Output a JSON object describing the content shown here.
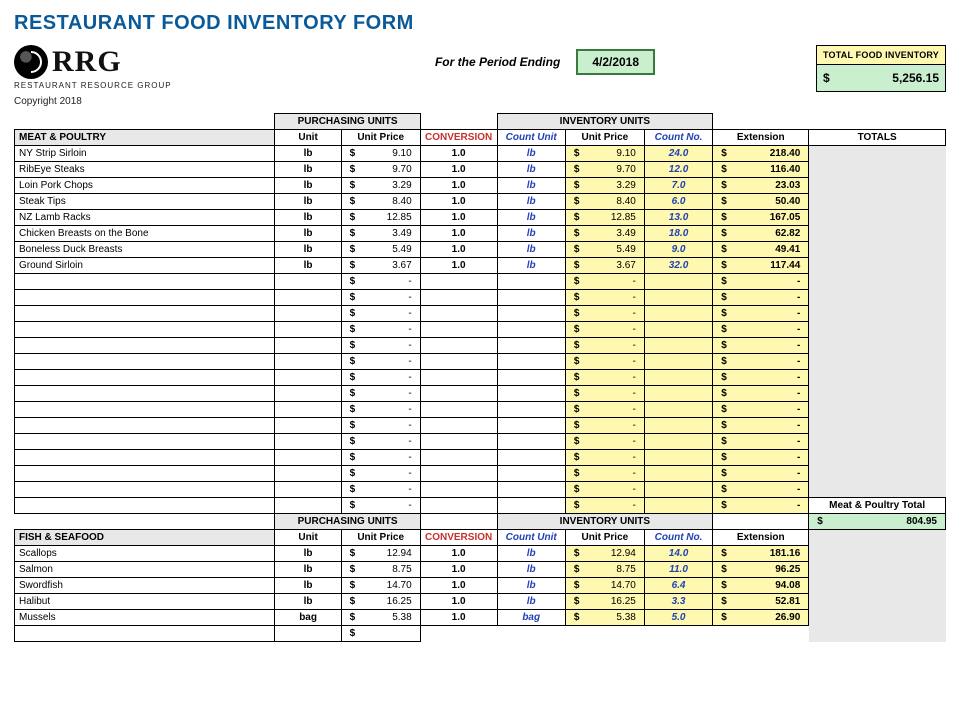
{
  "title": "RESTAURANT FOOD INVENTORY FORM",
  "logo": {
    "text": "RRG",
    "sub": "RESTAURANT RESOURCE GROUP"
  },
  "copyright": "Copyright 2018",
  "period": {
    "label": "For the Period Ending",
    "value": "4/2/2018"
  },
  "grand_total": {
    "label": "TOTAL FOOD INVENTORY",
    "currency": "$",
    "amount": "5,256.15"
  },
  "group_headers": {
    "purchasing": "PURCHASING UNITS",
    "inventory": "INVENTORY UNITS"
  },
  "col_headers": {
    "unit": "Unit",
    "unit_price": "Unit Price",
    "conversion": "CONVERSION",
    "count_unit": "Count Unit",
    "inv_unit_price": "Unit Price",
    "count_no": "Count No.",
    "extension": "Extension",
    "totals": "TOTALS"
  },
  "sections": [
    {
      "title": "MEAT & POULTRY",
      "subtotal_label": "Meat & Poultry Total",
      "subtotal_amount": "804.95",
      "blank_rows": 15,
      "rows": [
        {
          "name": "NY Strip Sirloin",
          "unit": "lb",
          "up": "9.10",
          "conv": "1.0",
          "cu": "lb",
          "iup": "9.10",
          "cn": "24.0",
          "ext": "218.40"
        },
        {
          "name": "RibEye Steaks",
          "unit": "lb",
          "up": "9.70",
          "conv": "1.0",
          "cu": "lb",
          "iup": "9.70",
          "cn": "12.0",
          "ext": "116.40"
        },
        {
          "name": "Loin Pork Chops",
          "unit": "lb",
          "up": "3.29",
          "conv": "1.0",
          "cu": "lb",
          "iup": "3.29",
          "cn": "7.0",
          "ext": "23.03"
        },
        {
          "name": "Steak Tips",
          "unit": "lb",
          "up": "8.40",
          "conv": "1.0",
          "cu": "lb",
          "iup": "8.40",
          "cn": "6.0",
          "ext": "50.40"
        },
        {
          "name": "NZ Lamb Racks",
          "unit": "lb",
          "up": "12.85",
          "conv": "1.0",
          "cu": "lb",
          "iup": "12.85",
          "cn": "13.0",
          "ext": "167.05"
        },
        {
          "name": "Chicken Breasts on the Bone",
          "unit": "lb",
          "up": "3.49",
          "conv": "1.0",
          "cu": "lb",
          "iup": "3.49",
          "cn": "18.0",
          "ext": "62.82"
        },
        {
          "name": "Boneless Duck Breasts",
          "unit": "lb",
          "up": "5.49",
          "conv": "1.0",
          "cu": "lb",
          "iup": "5.49",
          "cn": "9.0",
          "ext": "49.41"
        },
        {
          "name": "Ground Sirloin",
          "unit": "lb",
          "up": "3.67",
          "conv": "1.0",
          "cu": "lb",
          "iup": "3.67",
          "cn": "32.0",
          "ext": "117.44"
        }
      ]
    },
    {
      "title": "FISH & SEAFOOD",
      "rows": [
        {
          "name": "Scallops",
          "unit": "lb",
          "up": "12.94",
          "conv": "1.0",
          "cu": "lb",
          "iup": "12.94",
          "cn": "14.0",
          "ext": "181.16"
        },
        {
          "name": "Salmon",
          "unit": "lb",
          "up": "8.75",
          "conv": "1.0",
          "cu": "lb",
          "iup": "8.75",
          "cn": "11.0",
          "ext": "96.25"
        },
        {
          "name": "Swordfish",
          "unit": "lb",
          "up": "14.70",
          "conv": "1.0",
          "cu": "lb",
          "iup": "14.70",
          "cn": "6.4",
          "ext": "94.08"
        },
        {
          "name": "Halibut",
          "unit": "lb",
          "up": "16.25",
          "conv": "1.0",
          "cu": "lb",
          "iup": "16.25",
          "cn": "3.3",
          "ext": "52.81"
        },
        {
          "name": "Mussels",
          "unit": "bag",
          "up": "5.38",
          "conv": "1.0",
          "cu": "bag",
          "iup": "5.38",
          "cn": "5.0",
          "ext": "26.90"
        }
      ]
    }
  ]
}
